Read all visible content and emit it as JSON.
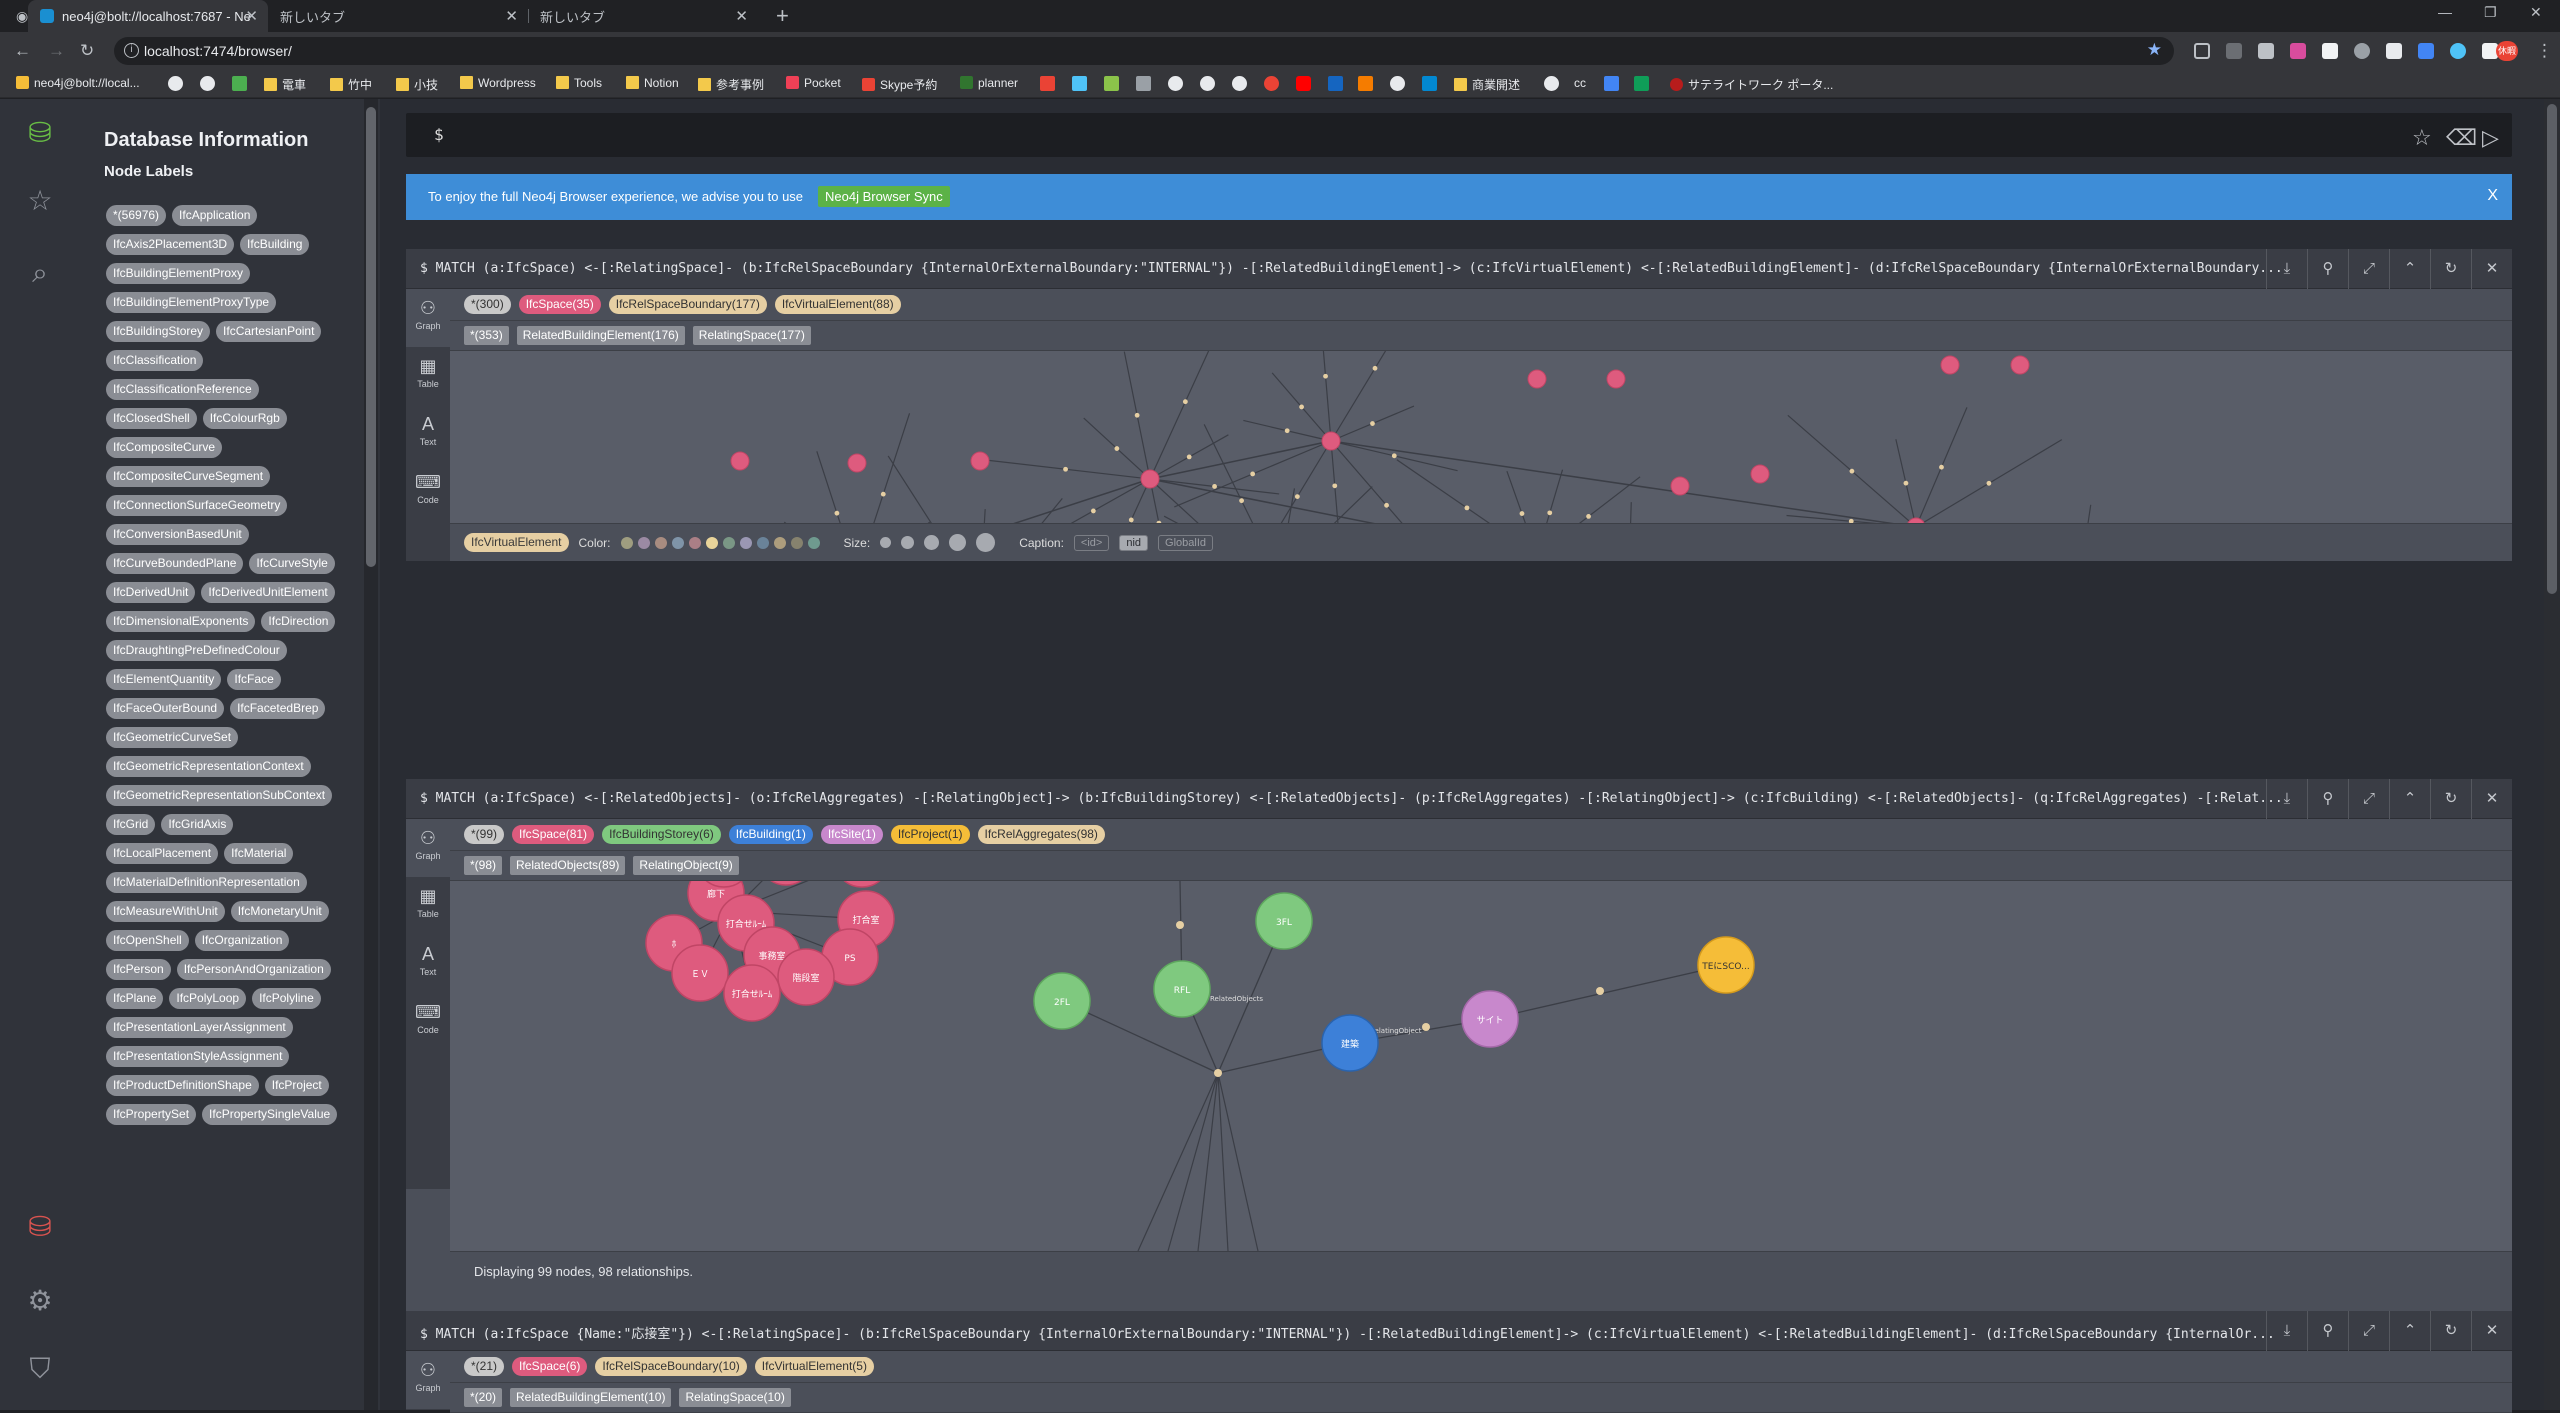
{
  "browser": {
    "tabs": [
      {
        "title": "neo4j@bolt://localhost:7687 - Ne",
        "active": true
      },
      {
        "title": "新しいタブ",
        "active": false
      },
      {
        "title": "新しいタブ",
        "active": false
      }
    ],
    "url": "localhost:7474/browser/",
    "bookmarks": [
      "neo4j@bolt://local...",
      "電車",
      "竹中",
      "小技",
      "Wordpress",
      "Tools",
      "Notion",
      "参考事例",
      "Pocket",
      "Skype予約",
      "planner",
      "商業開述",
      "サテライトワーク ポータ..."
    ],
    "bookmark_cc": "cc",
    "profile_label": "休暇"
  },
  "sidebar": {
    "title": "Database Information",
    "subtitle": "Node Labels",
    "labels": [
      "*(56976)",
      "IfcApplication",
      "IfcAxis2Placement3D",
      "IfcBuilding",
      "IfcBuildingElementProxy",
      "IfcBuildingElementProxyType",
      "IfcBuildingStorey",
      "IfcCartesianPoint",
      "IfcClassification",
      "IfcClassificationReference",
      "IfcClosedShell",
      "IfcColourRgb",
      "IfcCompositeCurve",
      "IfcCompositeCurveSegment",
      "IfcConnectionSurfaceGeometry",
      "IfcConversionBasedUnit",
      "IfcCurveBoundedPlane",
      "IfcCurveStyle",
      "IfcDerivedUnit",
      "IfcDerivedUnitElement",
      "IfcDimensionalExponents",
      "IfcDirection",
      "IfcDraughtingPreDefinedColour",
      "IfcElementQuantity",
      "IfcFace",
      "IfcFaceOuterBound",
      "IfcFacetedBrep",
      "IfcGeometricCurveSet",
      "IfcGeometricRepresentationContext",
      "IfcGeometricRepresentationSubContext",
      "IfcGrid",
      "IfcGridAxis",
      "IfcLocalPlacement",
      "IfcMaterial",
      "IfcMaterialDefinitionRepresentation",
      "IfcMeasureWithUnit",
      "IfcMonetaryUnit",
      "IfcOpenShell",
      "IfcOrganization",
      "IfcPerson",
      "IfcPersonAndOrganization",
      "IfcPlane",
      "IfcPolyLoop",
      "IfcPolyline",
      "IfcPresentationLayerAssignment",
      "IfcPresentationStyleAssignment",
      "IfcProductDefinitionShape",
      "IfcProject",
      "IfcPropertySet",
      "IfcPropertySingleValue"
    ]
  },
  "editor": {
    "prompt": "$"
  },
  "banner": {
    "text": "To enjoy the full Neo4j Browser experience, we advise you to use",
    "button": "Neo4j Browser Sync",
    "close": "X"
  },
  "frame_side": {
    "graph": "Graph",
    "table": "Table",
    "text": "Text",
    "code": "Code"
  },
  "frames": [
    {
      "query": "$ MATCH (a:IfcSpace) <-[:RelatingSpace]- (b:IfcRelSpaceBoundary {InternalOrExternalBoundary:\"INTERNAL\"}) -[:RelatedBuildingElement]-> (c:IfcVirtualElement) <-[:RelatedBuildingElement]- (d:IfcRelSpaceBoundary {InternalOrExternalBoundary...",
      "labels": [
        {
          "text": "*(300)",
          "color": "#c9c9c9"
        },
        {
          "text": "IfcSpace(35)",
          "color": "#de5b7e"
        },
        {
          "text": "IfcRelSpaceBoundary(177)",
          "color": "#e6cfa3"
        },
        {
          "text": "IfcVirtualElement(88)",
          "color": "#e6cfa3"
        }
      ],
      "rels": [
        "*(353)",
        "RelatedBuildingElement(176)",
        "RelatingSpace(177)"
      ],
      "style": {
        "selected": "IfcVirtualElement",
        "color_label": "Color:",
        "size_label": "Size:",
        "caption_label": "Caption:",
        "captions": [
          "<id>",
          "nid",
          "GlobalId"
        ],
        "swatches": [
          "#9f9d80",
          "#9b8aa3",
          "#a88c80",
          "#7f94a8",
          "#aa7f86",
          "#e9d49a",
          "#7a9785",
          "#9a97b3",
          "#6a8399",
          "#ad9d7d",
          "#86826e",
          "#6f9a8f"
        ]
      }
    },
    {
      "query": "$ MATCH (a:IfcSpace) <-[:RelatedObjects]- (o:IfcRelAggregates) -[:RelatingObject]-> (b:IfcBuildingStorey) <-[:RelatedObjects]- (p:IfcRelAggregates) -[:RelatingObject]-> (c:IfcBuilding) <-[:RelatedObjects]- (q:IfcRelAggregates) -[:Relat...",
      "labels": [
        {
          "text": "*(99)",
          "color": "#c9c9c9"
        },
        {
          "text": "IfcSpace(81)",
          "color": "#de5b7e"
        },
        {
          "text": "IfcBuildingStorey(6)",
          "color": "#7fc97f"
        },
        {
          "text": "IfcBuilding(1)",
          "color": "#3d80d8"
        },
        {
          "text": "IfcSite(1)",
          "color": "#c888cc"
        },
        {
          "text": "IfcProject(1)",
          "color": "#f5bd38"
        },
        {
          "text": "IfcRelAggregates(98)",
          "color": "#e6cfa3"
        }
      ],
      "rels": [
        "*(98)",
        "RelatedObjects(89)",
        "RelatingObject(9)"
      ],
      "status": "Displaying 99 nodes, 98 relationships.",
      "node_captions": {
        "s1": "廊下",
        "s2": "打合せﾙｰﾑ",
        "s3": "打合室",
        "s4": "ﾎ",
        "s5": "事務室",
        "s6": "PS",
        "s7": "ＥＶ",
        "s8": "階段室",
        "s9": "打合せﾙｰﾑ",
        "f2": "2FL",
        "f3": "3FL",
        "rfl": "RFL",
        "bld": "建築",
        "site": "サイト",
        "proj": "TEにSCO..."
      },
      "rel_captions": {
        "related": "RelatedObjects",
        "relating": "RelatingObject"
      }
    },
    {
      "query": "$ MATCH (a:IfcSpace {Name:\"応接室\"}) <-[:RelatingSpace]- (b:IfcRelSpaceBoundary {InternalOrExternalBoundary:\"INTERNAL\"}) -[:RelatedBuildingElement]-> (c:IfcVirtualElement) <-[:RelatedBuildingElement]- (d:IfcRelSpaceBoundary {InternalOr...",
      "labels": [
        {
          "text": "*(21)",
          "color": "#c9c9c9"
        },
        {
          "text": "IfcSpace(6)",
          "color": "#de5b7e"
        },
        {
          "text": "IfcRelSpaceBoundary(10)",
          "color": "#e6cfa3"
        },
        {
          "text": "IfcVirtualElement(5)",
          "color": "#e6cfa3"
        }
      ],
      "rels": [
        "*(20)",
        "RelatedBuildingElement(10)",
        "RelatingSpace(10)"
      ]
    }
  ]
}
